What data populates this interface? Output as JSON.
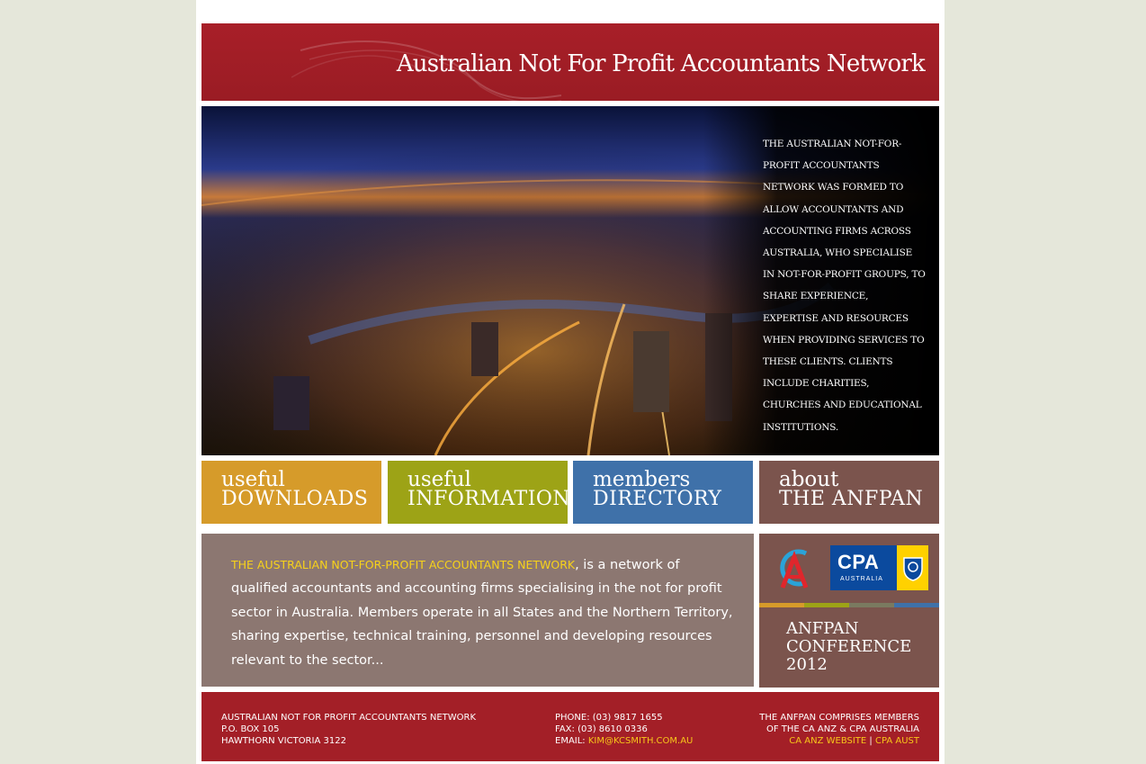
{
  "banner": {
    "title": "Australian Not For Profit Accountants Network"
  },
  "hero": {
    "text": "The Australian Not-For-Profit Accountants Network was formed to allow accountants and accounting firms across Australia, who specialise in not-for-profit groups, to share experience, expertise and resources when providing services to these clients. Clients include charities, churches and educational institutions."
  },
  "tiles": [
    {
      "line1": "useful",
      "line2": "DOWNLOADS",
      "color": "#d69b2a"
    },
    {
      "line1": "useful",
      "line2": "INFORMATION",
      "color": "#9da316"
    },
    {
      "line1": "members",
      "line2": "DIRECTORY",
      "color": "#3f71a9"
    },
    {
      "line1": "about",
      "line2": "THE ANFPAN",
      "color": "#7b544d"
    }
  ],
  "intro": {
    "highlight": "THE AUSTRALIAN NOT-FOR-PROFIT ACCOUNTANTS NETWORK",
    "body": ", is a network of qualified accountants and accounting firms specialising in the not for profit sector in Australia. Members operate in all States and the Northern Territory, sharing expertise, technical training, personnel and developing resources relevant to the sector..."
  },
  "sidebar": {
    "cpa_logo_text": "CPA",
    "cpa_logo_sub": "AUSTRALIA",
    "conference_line1": "ANFPAN",
    "conference_line2": "CONFERENCE",
    "conference_line3": "2012"
  },
  "footer": {
    "address": [
      "Australian Not For Profit Accountants Network",
      "P.O. Box 105",
      "Hawthorn Victoria 3122"
    ],
    "phone": "Phone: (03) 9817 1655",
    "fax": "Fax: (03) 8610 0336",
    "email_label": "Email: ",
    "email": "kim@kcsmith.com.au",
    "members_line1": "The ANFPAN comprises members",
    "members_line2": "of the CA ANZ & CPA Australia",
    "ca_link": "CA ANZ Website",
    "separator": "|",
    "cpa_link": "CPA Aust"
  },
  "colors": {
    "brand_red": "#a31f27",
    "highlight_yellow": "#f7d21a",
    "page_bg": "#e5e7da"
  }
}
